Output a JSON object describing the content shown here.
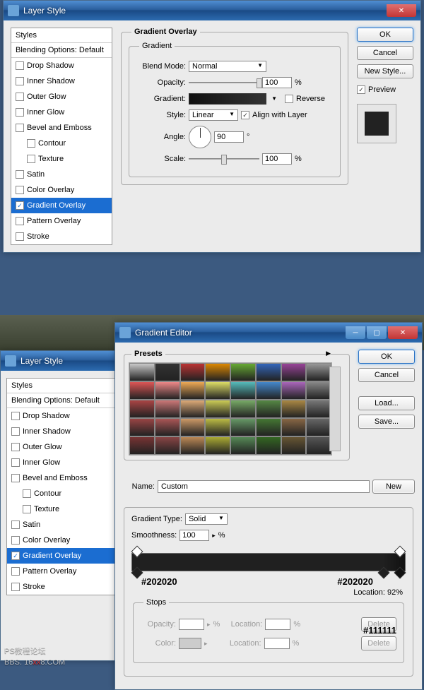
{
  "window1": {
    "title": "Layer Style",
    "styles_header": "Styles",
    "blending_default": "Blending Options: Default",
    "items": [
      {
        "label": "Drop Shadow",
        "checked": false
      },
      {
        "label": "Inner Shadow",
        "checked": false
      },
      {
        "label": "Outer Glow",
        "checked": false
      },
      {
        "label": "Inner Glow",
        "checked": false
      },
      {
        "label": "Bevel and Emboss",
        "checked": false
      },
      {
        "label": "Contour",
        "checked": false,
        "indent": true
      },
      {
        "label": "Texture",
        "checked": false,
        "indent": true
      },
      {
        "label": "Satin",
        "checked": false
      },
      {
        "label": "Color Overlay",
        "checked": false
      },
      {
        "label": "Gradient Overlay",
        "checked": true,
        "selected": true
      },
      {
        "label": "Pattern Overlay",
        "checked": false
      },
      {
        "label": "Stroke",
        "checked": false
      }
    ],
    "section_title": "Gradient Overlay",
    "gradient_title": "Gradient",
    "labels": {
      "blend_mode": "Blend Mode:",
      "opacity": "Opacity:",
      "gradient": "Gradient:",
      "style": "Style:",
      "angle": "Angle:",
      "scale": "Scale:",
      "reverse": "Reverse",
      "align": "Align with Layer"
    },
    "values": {
      "blend_mode": "Normal",
      "opacity": "100",
      "style": "Linear",
      "angle": "90",
      "scale": "100",
      "percent": "%",
      "degree": "°"
    },
    "buttons": {
      "ok": "OK",
      "cancel": "Cancel",
      "new_style": "New Style...",
      "preview": "Preview"
    }
  },
  "window2": {
    "title": "Layer Style",
    "styles_header": "Styles",
    "blending_default": "Blending Options: Default",
    "items": [
      {
        "label": "Drop Shadow"
      },
      {
        "label": "Inner Shadow"
      },
      {
        "label": "Outer Glow"
      },
      {
        "label": "Inner Glow"
      },
      {
        "label": "Bevel and Emboss"
      },
      {
        "label": "Contour",
        "indent": true
      },
      {
        "label": "Texture",
        "indent": true
      },
      {
        "label": "Satin"
      },
      {
        "label": "Color Overlay"
      },
      {
        "label": "Gradient Overlay",
        "checked": true,
        "selected": true
      },
      {
        "label": "Pattern Overlay"
      },
      {
        "label": "Stroke"
      }
    ]
  },
  "editor": {
    "title": "Gradient Editor",
    "presets_label": "Presets",
    "preset_colors": [
      "#c8c8c8",
      "#333",
      "#b33",
      "#d80",
      "#6a3",
      "#36b",
      "#949",
      "#999",
      "#d55",
      "#e88",
      "#ea5",
      "#dd6",
      "#5bb",
      "#48c",
      "#a6b",
      "#888",
      "#a44",
      "#c77",
      "#da7",
      "#cc5",
      "#7a6",
      "#584",
      "#a84",
      "#777",
      "#944",
      "#a55",
      "#c96",
      "#bb4",
      "#696",
      "#473",
      "#864",
      "#666",
      "#733",
      "#844",
      "#b85",
      "#aa3",
      "#585",
      "#362",
      "#653",
      "#555"
    ],
    "name_label": "Name:",
    "name_value": "Custom",
    "grad_type_label": "Gradient Type:",
    "grad_type_value": "Solid",
    "smoothness_label": "Smoothness:",
    "smoothness_value": "100",
    "percent": "%",
    "stops_title": "Stops",
    "opacity_label": "Opacity:",
    "location_label": "Location:",
    "color_label": "Color:",
    "delete": "Delete",
    "annotations": {
      "left_hex": "#202020",
      "right_hex": "#202020",
      "location": "Location: 92%",
      "bottom_hex": "#111111"
    },
    "buttons": {
      "ok": "OK",
      "cancel": "Cancel",
      "load": "Load...",
      "save": "Save...",
      "new": "New"
    }
  },
  "watermark": {
    "t1": "PS教程论坛",
    "t2": "BBS. 16",
    "t3": "xx",
    "t4": "8.COM"
  }
}
